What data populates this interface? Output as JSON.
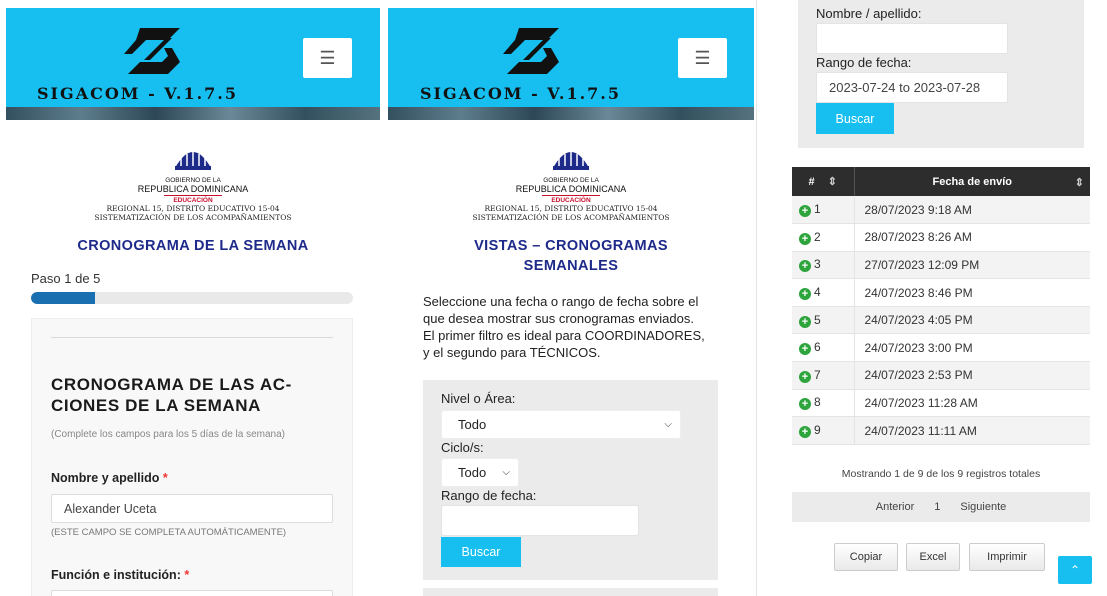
{
  "brand": {
    "name": "SIGACOM - V.1.7.5",
    "menu_icon": "hamburger-icon"
  },
  "gov_header": {
    "line1": "GOBIERNO DE LA",
    "line2": "REPUBLICA DOMINICANA",
    "line3": "EDUCACIÓN",
    "line4": "REGIONAL 15, DISTRITO EDUCATIVO 15-04",
    "line5": "SISTEMATIZACIÓN DE LOS ACOMPAÑAMIENTOS"
  },
  "panel1": {
    "title": "CRONOGRAMA DE LA SEMANA",
    "step_label": "Paso 1 de 5",
    "progress": 0.2,
    "form_heading_line1": "CRONOGRAMA DE LAS AC-",
    "form_heading_line2": "CIONES DE LA SEMANA",
    "form_note": "(Complete los campos para los 5 días de la semana)",
    "name_label": "Nombre y apellido",
    "name_value": "Alexander Uceta",
    "name_help": "(ESTE CAMPO SE COMPLETA AUTOMÁTICAMENTE)",
    "function_label": "Función e institución:",
    "required_mark": "*"
  },
  "panel2": {
    "title_line1": "VISTAS – CRONOGRAMAS",
    "title_line2": "SEMANALES",
    "description": "Seleccione una fecha o rango de fecha sobre el que desea mostrar sus cronogramas enviados. El primer filtro es ideal para COORDINADORES, y el segundo para TÉCNICOS.",
    "level_label": "Nivel o Área:",
    "level_value": "Todo",
    "cycle_label": "Ciclo/s:",
    "cycle_value": "Todo",
    "date_label": "Rango de fecha:",
    "date_value": "",
    "search_button": "Buscar"
  },
  "panel3": {
    "name_label": "Nombre / apellido:",
    "date_label": "Rango de fecha:",
    "date_value": "2023-07-24 to 2023-07-28",
    "search_button": "Buscar",
    "col_index": "#",
    "col_date": "Fecha de envío",
    "rows": [
      {
        "n": "1",
        "date": "28/07/2023 9:18 AM"
      },
      {
        "n": "2",
        "date": "28/07/2023 8:26 AM"
      },
      {
        "n": "3",
        "date": "27/07/2023 12:09 PM"
      },
      {
        "n": "4",
        "date": "24/07/2023 8:46 PM"
      },
      {
        "n": "5",
        "date": "24/07/2023 4:05 PM"
      },
      {
        "n": "6",
        "date": "24/07/2023 3:00 PM"
      },
      {
        "n": "7",
        "date": "24/07/2023 2:53 PM"
      },
      {
        "n": "8",
        "date": "24/07/2023 11:28 AM"
      },
      {
        "n": "9",
        "date": "24/07/2023 11:11 AM"
      }
    ],
    "info": "Mostrando 1 de 9 de los 9 registros totales",
    "prev": "Anterior",
    "page": "1",
    "next": "Siguiente",
    "copy_button": "Copiar",
    "excel_button": "Excel",
    "print_button": "Imprimir"
  },
  "colors": {
    "brand_blue": "#16bff0",
    "title_blue": "#1d2a8a",
    "progress": "#1a6fb0",
    "plus_green": "#2ea43d"
  }
}
